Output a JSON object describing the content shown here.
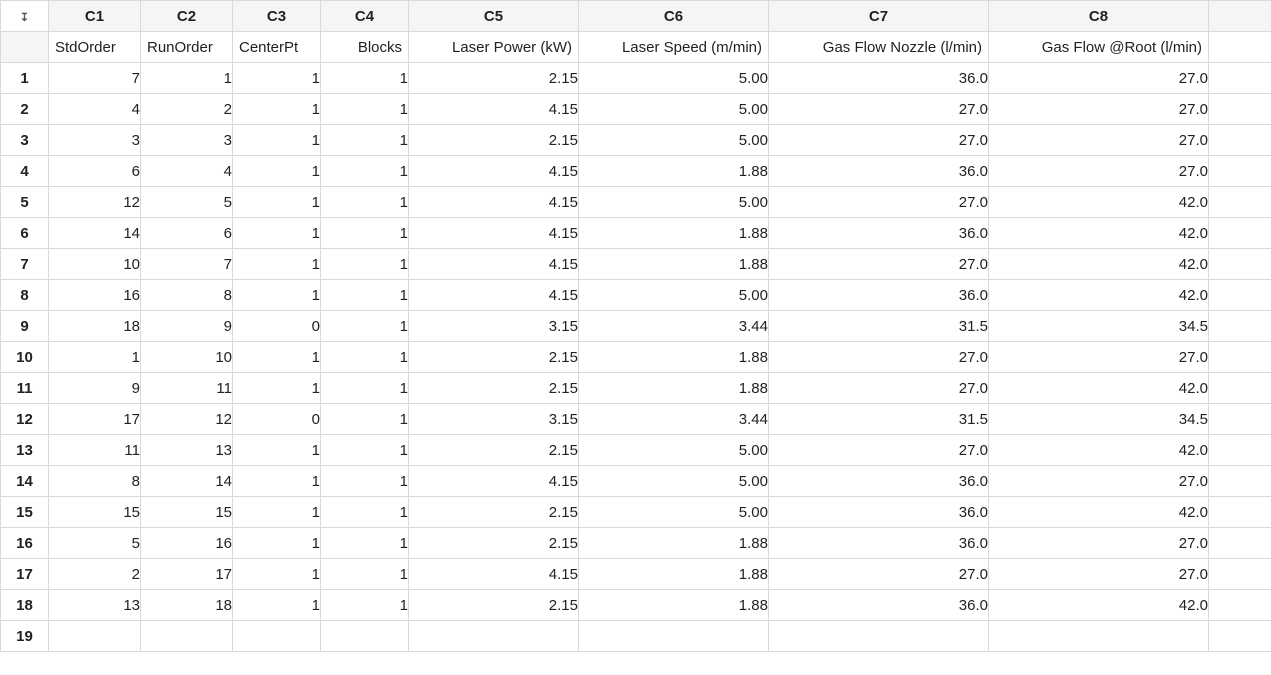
{
  "corner_glyph": "↧",
  "columns": [
    {
      "id": "C1",
      "name": "StdOrder",
      "align": "left"
    },
    {
      "id": "C2",
      "name": "RunOrder",
      "align": "left"
    },
    {
      "id": "C3",
      "name": "CenterPt",
      "align": "left"
    },
    {
      "id": "C4",
      "name": "Blocks",
      "align": "right"
    },
    {
      "id": "C5",
      "name": "Laser Power (kW)",
      "align": "right"
    },
    {
      "id": "C6",
      "name": "Laser Speed (m/min)",
      "align": "right"
    },
    {
      "id": "C7",
      "name": "Gas Flow Nozzle (l/min)",
      "align": "right"
    },
    {
      "id": "C8",
      "name": "Gas Flow @Root (l/min)",
      "align": "right"
    }
  ],
  "rows": [
    {
      "n": "1",
      "c": [
        "7",
        "1",
        "1",
        "1",
        "2.15",
        "5.00",
        "36.0",
        "27.0"
      ]
    },
    {
      "n": "2",
      "c": [
        "4",
        "2",
        "1",
        "1",
        "4.15",
        "5.00",
        "27.0",
        "27.0"
      ]
    },
    {
      "n": "3",
      "c": [
        "3",
        "3",
        "1",
        "1",
        "2.15",
        "5.00",
        "27.0",
        "27.0"
      ]
    },
    {
      "n": "4",
      "c": [
        "6",
        "4",
        "1",
        "1",
        "4.15",
        "1.88",
        "36.0",
        "27.0"
      ]
    },
    {
      "n": "5",
      "c": [
        "12",
        "5",
        "1",
        "1",
        "4.15",
        "5.00",
        "27.0",
        "42.0"
      ]
    },
    {
      "n": "6",
      "c": [
        "14",
        "6",
        "1",
        "1",
        "4.15",
        "1.88",
        "36.0",
        "42.0"
      ]
    },
    {
      "n": "7",
      "c": [
        "10",
        "7",
        "1",
        "1",
        "4.15",
        "1.88",
        "27.0",
        "42.0"
      ]
    },
    {
      "n": "8",
      "c": [
        "16",
        "8",
        "1",
        "1",
        "4.15",
        "5.00",
        "36.0",
        "42.0"
      ]
    },
    {
      "n": "9",
      "c": [
        "18",
        "9",
        "0",
        "1",
        "3.15",
        "3.44",
        "31.5",
        "34.5"
      ]
    },
    {
      "n": "10",
      "c": [
        "1",
        "10",
        "1",
        "1",
        "2.15",
        "1.88",
        "27.0",
        "27.0"
      ]
    },
    {
      "n": "11",
      "c": [
        "9",
        "11",
        "1",
        "1",
        "2.15",
        "1.88",
        "27.0",
        "42.0"
      ]
    },
    {
      "n": "12",
      "c": [
        "17",
        "12",
        "0",
        "1",
        "3.15",
        "3.44",
        "31.5",
        "34.5"
      ]
    },
    {
      "n": "13",
      "c": [
        "11",
        "13",
        "1",
        "1",
        "2.15",
        "5.00",
        "27.0",
        "42.0"
      ]
    },
    {
      "n": "14",
      "c": [
        "8",
        "14",
        "1",
        "1",
        "4.15",
        "5.00",
        "36.0",
        "27.0"
      ]
    },
    {
      "n": "15",
      "c": [
        "15",
        "15",
        "1",
        "1",
        "2.15",
        "5.00",
        "36.0",
        "42.0"
      ]
    },
    {
      "n": "16",
      "c": [
        "5",
        "16",
        "1",
        "1",
        "2.15",
        "1.88",
        "36.0",
        "27.0"
      ]
    },
    {
      "n": "17",
      "c": [
        "2",
        "17",
        "1",
        "1",
        "4.15",
        "1.88",
        "27.0",
        "27.0"
      ]
    },
    {
      "n": "18",
      "c": [
        "13",
        "18",
        "1",
        "1",
        "2.15",
        "1.88",
        "36.0",
        "42.0"
      ]
    }
  ],
  "trailing_row_label": "19",
  "chart_data": {
    "type": "table",
    "columns": [
      "StdOrder",
      "RunOrder",
      "CenterPt",
      "Blocks",
      "Laser Power (kW)",
      "Laser Speed (m/min)",
      "Gas Flow Nozzle (l/min)",
      "Gas Flow @Root (l/min)"
    ],
    "data": [
      [
        7,
        1,
        1,
        1,
        2.15,
        5.0,
        36.0,
        27.0
      ],
      [
        4,
        2,
        1,
        1,
        4.15,
        5.0,
        27.0,
        27.0
      ],
      [
        3,
        3,
        1,
        1,
        2.15,
        5.0,
        27.0,
        27.0
      ],
      [
        6,
        4,
        1,
        1,
        4.15,
        1.88,
        36.0,
        27.0
      ],
      [
        12,
        5,
        1,
        1,
        4.15,
        5.0,
        27.0,
        42.0
      ],
      [
        14,
        6,
        1,
        1,
        4.15,
        1.88,
        36.0,
        42.0
      ],
      [
        10,
        7,
        1,
        1,
        4.15,
        1.88,
        27.0,
        42.0
      ],
      [
        16,
        8,
        1,
        1,
        4.15,
        5.0,
        36.0,
        42.0
      ],
      [
        18,
        9,
        0,
        1,
        3.15,
        3.44,
        31.5,
        34.5
      ],
      [
        1,
        10,
        1,
        1,
        2.15,
        1.88,
        27.0,
        27.0
      ],
      [
        9,
        11,
        1,
        1,
        2.15,
        1.88,
        27.0,
        42.0
      ],
      [
        17,
        12,
        0,
        1,
        3.15,
        3.44,
        31.5,
        34.5
      ],
      [
        11,
        13,
        1,
        1,
        2.15,
        5.0,
        27.0,
        42.0
      ],
      [
        8,
        14,
        1,
        1,
        4.15,
        5.0,
        36.0,
        27.0
      ],
      [
        15,
        15,
        1,
        1,
        2.15,
        5.0,
        36.0,
        42.0
      ],
      [
        5,
        16,
        1,
        1,
        2.15,
        1.88,
        36.0,
        27.0
      ],
      [
        2,
        17,
        1,
        1,
        4.15,
        1.88,
        27.0,
        27.0
      ],
      [
        13,
        18,
        1,
        1,
        2.15,
        1.88,
        36.0,
        42.0
      ]
    ]
  }
}
